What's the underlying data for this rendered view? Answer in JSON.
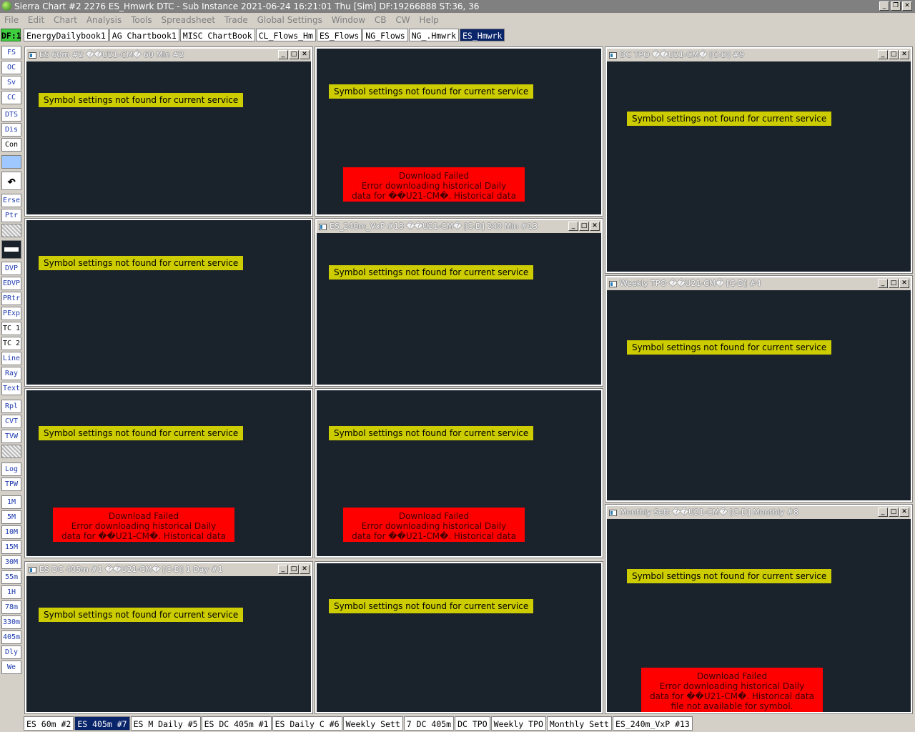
{
  "window": {
    "title": "Sierra Chart #2 2276 ES_Hmwrk  DTC - Sub Instance 2021-06-24  16:21:01 Thu [Sim]  DF:19266888  ST:36, 36",
    "minimize_glyph": "_",
    "restore_glyph": "❐",
    "close_glyph": "✕"
  },
  "menu": [
    "File",
    "Edit",
    "Chart",
    "Analysis",
    "Tools",
    "Spreadsheet",
    "Trade",
    "Global Settings",
    "Window",
    "CB",
    "CW",
    "Help"
  ],
  "chartbook_tabs": {
    "df_indicator": "DF:1",
    "tabs": [
      {
        "label": "EnergyDailybook1",
        "active": false
      },
      {
        "label": "AG Chartbook1",
        "active": false
      },
      {
        "label": "MISC ChartBook",
        "active": false
      },
      {
        "label": "CL_Flows_Hm",
        "active": false
      },
      {
        "label": "ES_Flows",
        "active": false
      },
      {
        "label": "NG_Flows",
        "active": false
      },
      {
        "label": "NG_.Hmwrk",
        "active": false
      },
      {
        "label": "ES_Hmwrk",
        "active": true
      }
    ]
  },
  "toolbar": [
    {
      "label": "FS"
    },
    {
      "label": "OC"
    },
    {
      "label": "Sv"
    },
    {
      "label": "CC"
    },
    {
      "label": "DTS"
    },
    {
      "label": "Dis"
    },
    {
      "label": "Con"
    },
    {
      "label": "",
      "icon": "selected-tool"
    },
    {
      "label": "↶",
      "icon": "undo-arrow-icon"
    },
    {
      "label": "Erse"
    },
    {
      "label": "Ptr"
    },
    {
      "label": "",
      "icon": "hatch-pattern"
    },
    {
      "label": "",
      "icon": "line-width"
    },
    {
      "label": "DVP"
    },
    {
      "label": "EDVP"
    },
    {
      "label": "PRtr"
    },
    {
      "label": "PExp"
    },
    {
      "label": "TC 1"
    },
    {
      "label": "TC 2"
    },
    {
      "label": "Line"
    },
    {
      "label": "Ray"
    },
    {
      "label": "Text"
    },
    {
      "label": "Rpl"
    },
    {
      "label": "CVT"
    },
    {
      "label": "TVW"
    },
    {
      "label": "",
      "icon": "hatch-pattern"
    },
    {
      "label": "Log"
    },
    {
      "label": "TPW"
    },
    {
      "label": "1M"
    },
    {
      "label": "5M"
    },
    {
      "label": "10M"
    },
    {
      "label": "15M"
    },
    {
      "label": "30M"
    },
    {
      "label": "55m"
    },
    {
      "label": "1H"
    },
    {
      "label": "78m"
    },
    {
      "label": "330m"
    },
    {
      "label": "405m"
    },
    {
      "label": "Dly"
    },
    {
      "label": "We"
    }
  ],
  "messages": {
    "symbol_not_found": "Symbol settings not found for current service",
    "download_failed_title": "Download Failed",
    "download_failed_line1": "Error downloading historical Daily",
    "download_failed_line2": "data for ��U21-CM�.  Historical data",
    "download_failed_line3": "file not available for symbol."
  },
  "charts": {
    "c1": {
      "title": "ES 60m #2 ��U21-CM�  60 Min  #2"
    },
    "c2": {
      "title": "DC TPO ��U21-CM� [C-D]  #9"
    },
    "c3": {
      "title": "ES_240m_VxP #13 ��U21-CM� [C-D]  240 Min  #13"
    },
    "c4": {
      "title": "Weekly TPO ��U21-CM� [C-D]  #4"
    },
    "c5": {
      "title": "Monthly Sett ��U21-CM� [C-D]  Monthly  #8"
    },
    "c6": {
      "title": "ES DC 405m #1 ��U21-CM� [C-D]  1 Day  #1"
    }
  },
  "sheet_tabs": [
    {
      "label": "ES 60m #2",
      "active": false
    },
    {
      "label": "ES 405m #7",
      "active": true
    },
    {
      "label": "ES M Daily #5",
      "active": false
    },
    {
      "label": "ES DC 405m #1",
      "active": false
    },
    {
      "label": "ES Daily C #6",
      "active": false
    },
    {
      "label": "Weekly Sett",
      "active": false
    },
    {
      "label": "7 DC 405m",
      "active": false
    },
    {
      "label": "DC TPO",
      "active": false
    },
    {
      "label": "Weekly TPO",
      "active": false
    },
    {
      "label": "Monthly Sett",
      "active": false
    },
    {
      "label": "ES_240m_VxP #13",
      "active": false
    }
  ]
}
